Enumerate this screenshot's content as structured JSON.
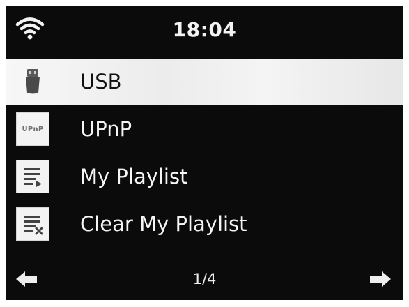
{
  "status_bar": {
    "time": "18:04",
    "wifi_icon": "wifi-icon"
  },
  "menu": {
    "items": [
      {
        "label": "USB",
        "icon": "usb-icon",
        "selected": true
      },
      {
        "label": "UPnP",
        "icon": "upnp-icon",
        "icon_text": "UPnP",
        "selected": false
      },
      {
        "label": "My Playlist",
        "icon": "playlist-play-icon",
        "selected": false
      },
      {
        "label": "Clear My Playlist",
        "icon": "playlist-clear-icon",
        "selected": false
      }
    ]
  },
  "footer": {
    "page": "1/4",
    "left_icon": "arrow-left-icon",
    "right_icon": "arrow-right-icon"
  },
  "colors": {
    "background": "#0b0b0b",
    "selection": "#f2f2f2",
    "text": "#f5f5f5",
    "selected_text": "#111111"
  }
}
